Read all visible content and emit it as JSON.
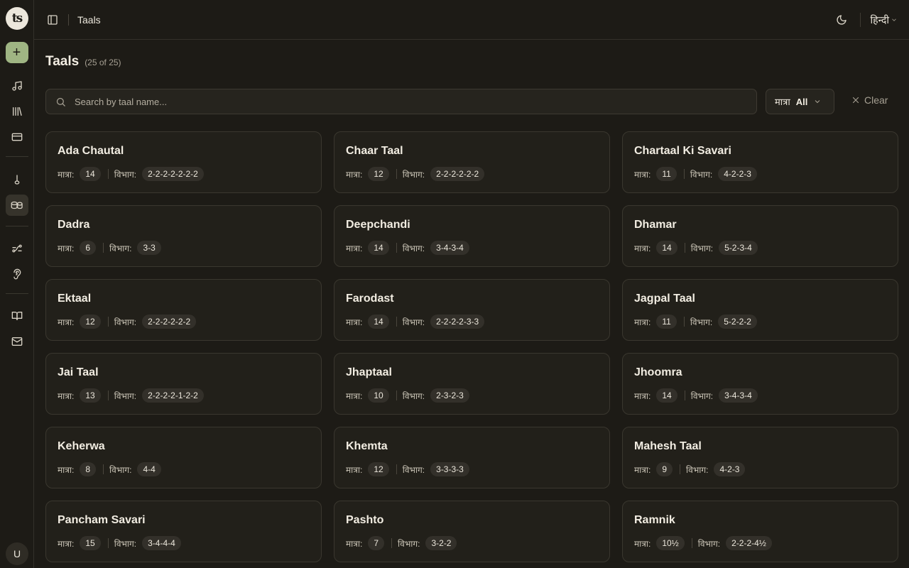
{
  "app": {
    "logo_text": "ts",
    "user_initial": "U"
  },
  "sidebar": {
    "items": [
      {
        "icon": "music-note-icon"
      },
      {
        "icon": "library-icon"
      },
      {
        "icon": "credit-card-icon"
      },
      {
        "icon": "tanpura-icon"
      },
      {
        "icon": "tabla-icon",
        "active": true
      },
      {
        "icon": "workflow-icon"
      },
      {
        "icon": "ear-icon"
      },
      {
        "icon": "book-icon"
      },
      {
        "icon": "mail-icon"
      }
    ]
  },
  "header": {
    "breadcrumb": "Taals",
    "language": "हिन्दी"
  },
  "page": {
    "title": "Taals",
    "count": "(25 of 25)"
  },
  "search": {
    "placeholder": "Search by taal name..."
  },
  "filter": {
    "label": "मात्रा",
    "value": "All"
  },
  "clear_label": "Clear",
  "labels": {
    "matra": "मात्रा:",
    "vibhag": "विभाग:"
  },
  "taals": [
    {
      "name": "Ada Chautal",
      "matra": "14",
      "vibhag": "2-2-2-2-2-2-2"
    },
    {
      "name": "Chaar Taal",
      "matra": "12",
      "vibhag": "2-2-2-2-2-2"
    },
    {
      "name": "Chartaal Ki Savari",
      "matra": "11",
      "vibhag": "4-2-2-3"
    },
    {
      "name": "Dadra",
      "matra": "6",
      "vibhag": "3-3"
    },
    {
      "name": "Deepchandi",
      "matra": "14",
      "vibhag": "3-4-3-4"
    },
    {
      "name": "Dhamar",
      "matra": "14",
      "vibhag": "5-2-3-4"
    },
    {
      "name": "Ektaal",
      "matra": "12",
      "vibhag": "2-2-2-2-2-2"
    },
    {
      "name": "Farodast",
      "matra": "14",
      "vibhag": "2-2-2-2-3-3"
    },
    {
      "name": "Jagpal Taal",
      "matra": "11",
      "vibhag": "5-2-2-2"
    },
    {
      "name": "Jai Taal",
      "matra": "13",
      "vibhag": "2-2-2-2-1-2-2"
    },
    {
      "name": "Jhaptaal",
      "matra": "10",
      "vibhag": "2-3-2-3"
    },
    {
      "name": "Jhoomra",
      "matra": "14",
      "vibhag": "3-4-3-4"
    },
    {
      "name": "Keherwa",
      "matra": "8",
      "vibhag": "4-4"
    },
    {
      "name": "Khemta",
      "matra": "12",
      "vibhag": "3-3-3-3"
    },
    {
      "name": "Mahesh Taal",
      "matra": "9",
      "vibhag": "4-2-3"
    },
    {
      "name": "Pancham Savari",
      "matra": "15",
      "vibhag": "3-4-4-4"
    },
    {
      "name": "Pashto",
      "matra": "7",
      "vibhag": "3-2-2"
    },
    {
      "name": "Ramnik",
      "matra": "10½",
      "vibhag": "2-2-2-4½"
    }
  ]
}
